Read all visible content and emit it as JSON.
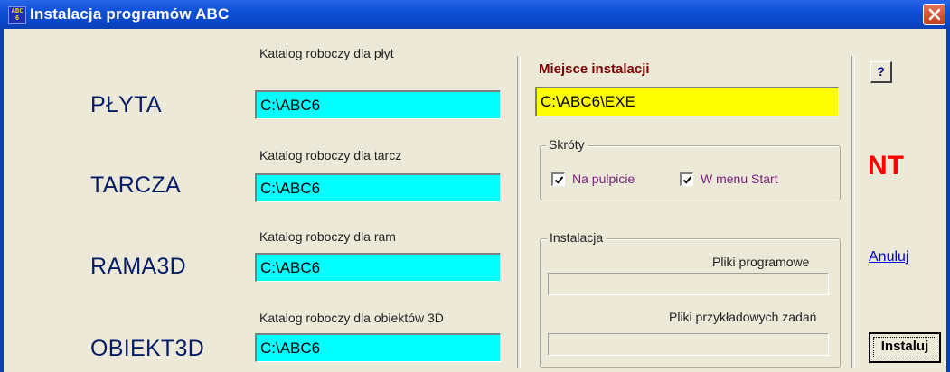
{
  "window": {
    "title": "Instalacja programów ABC",
    "app_icon_text": "ABC 6",
    "close_icon": "close-x-icon",
    "close_color": "#d2542e",
    "titlebar_color": "#0a46c9"
  },
  "left": {
    "rows": [
      {
        "label": "PŁYTA",
        "caption": "Katalog roboczy dla płyt",
        "value": "C:\\ABC6"
      },
      {
        "label": "TARCZA",
        "caption": "Katalog roboczy dla tarcz",
        "value": "C:\\ABC6"
      },
      {
        "label": "RAMA3D",
        "caption": "Katalog roboczy dla ram",
        "value": "C:\\ABC6"
      },
      {
        "label": "OBIEKT3D",
        "caption": "Katalog roboczy dla obiektów 3D",
        "value": "C:\\ABC6"
      }
    ],
    "field_color": "#00ffff"
  },
  "middle": {
    "install_location_heading": "Miejsce instalacji",
    "install_location_value": "C:\\ABC6\\EXE",
    "install_field_color": "#ffff00",
    "shortcuts": {
      "title": "Skróty",
      "desktop_label": "Na pulpicie",
      "desktop_checked": true,
      "start_menu_label": "W menu Start",
      "start_menu_checked": true
    },
    "install": {
      "title": "Instalacja",
      "program_files_label": "Pliki programowe",
      "program_files_progress": 0,
      "example_files_label": "Pliki przykładowych zadań",
      "example_files_progress": 0
    }
  },
  "right": {
    "help_label": "?",
    "nt_label": "NT",
    "nt_color": "#ff0000",
    "cancel_label": "Anuluj",
    "install_label": "Instaluj"
  }
}
